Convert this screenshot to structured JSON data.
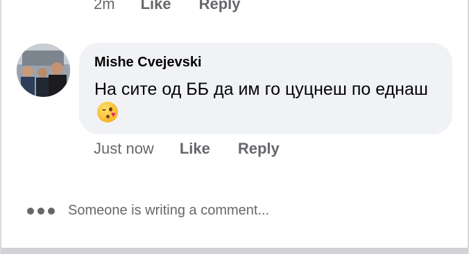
{
  "previous_comment": {
    "time": "2m",
    "like_label": "Like",
    "reply_label": "Reply"
  },
  "comment": {
    "author": "Mishe Cvejevski",
    "text": "На сите од ББ да им го цуцнеш по еднаш",
    "emoji": "kissing-wink-icon",
    "time": "Just now",
    "like_label": "Like",
    "reply_label": "Reply"
  },
  "typing_indicator": {
    "text": "Someone is writing a comment..."
  }
}
